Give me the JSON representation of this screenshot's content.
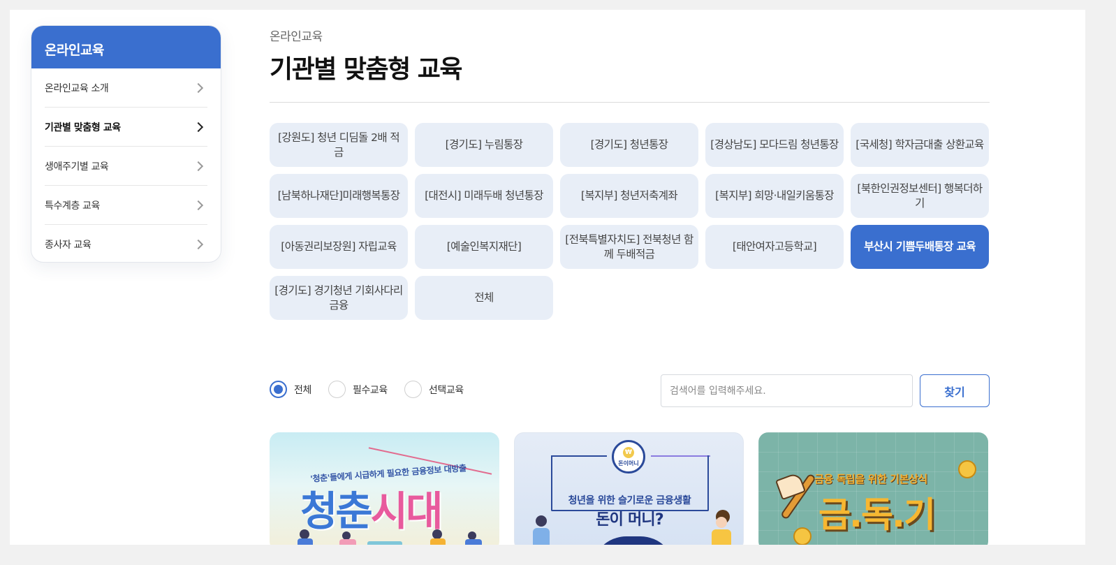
{
  "sidebar": {
    "header": "온라인교육",
    "items": [
      {
        "label": "온라인교육 소개",
        "active": false
      },
      {
        "label": "기관별 맞춤형 교육",
        "active": true
      },
      {
        "label": "생애주기별 교육",
        "active": false
      },
      {
        "label": "특수계층 교육",
        "active": false
      },
      {
        "label": "종사자 교육",
        "active": false
      }
    ]
  },
  "breadcrumb": "온라인교육",
  "page_title": "기관별 맞춤형 교육",
  "categories": [
    {
      "label": "[강원도] 청년 디딤돌 2배 적금",
      "active": false
    },
    {
      "label": "[경기도] 누림통장",
      "active": false
    },
    {
      "label": "[경기도] 청년통장",
      "active": false
    },
    {
      "label": "[경상남도] 모다드림 청년통장",
      "active": false
    },
    {
      "label": "[국세청] 학자금대출 상환교육",
      "active": false
    },
    {
      "label": "[남북하나재단]미래행복통장",
      "active": false
    },
    {
      "label": "[대전시] 미래두배 청년통장",
      "active": false
    },
    {
      "label": "[복지부] 청년저축계좌",
      "active": false
    },
    {
      "label": "[복지부] 희망·내일키움통장",
      "active": false
    },
    {
      "label": "[북한인권정보센터] 행복더하기",
      "active": false
    },
    {
      "label": "[아동권리보장원] 자립교육",
      "active": false
    },
    {
      "label": "[예술인복지재단]",
      "active": false
    },
    {
      "label": "[전북특별자치도] 전북청년 함께 두배적금",
      "active": false
    },
    {
      "label": "[태안여자고등학교]",
      "active": false
    },
    {
      "label": "부산시 기쁨두배통장 교육",
      "active": true
    },
    {
      "label": "[경기도] 경기청년 기회사다리금융",
      "active": false
    },
    {
      "label": "전체",
      "active": false
    }
  ],
  "filter": {
    "options": [
      {
        "label": "전체",
        "checked": true
      },
      {
        "label": "필수교육",
        "checked": false
      },
      {
        "label": "선택교육",
        "checked": false
      }
    ],
    "search_placeholder": "검색어를 입력해주세요.",
    "search_button": "찾기"
  },
  "cards": [
    {
      "subtitle": "'청춘'들에게 시급하게 필요한 금융정보 대방출",
      "title_a": "청춘",
      "title_b": "시대"
    },
    {
      "badge": "돈이머니",
      "line1": "청년을 위한 슬기로운 금융생활",
      "line2": "돈이 머니?"
    },
    {
      "subtitle": "금융 독립을 위한 기본상식",
      "title": "금.독.기"
    }
  ],
  "colors": {
    "accent": "#3a6fcf",
    "category_bg": "#e8eef7"
  }
}
